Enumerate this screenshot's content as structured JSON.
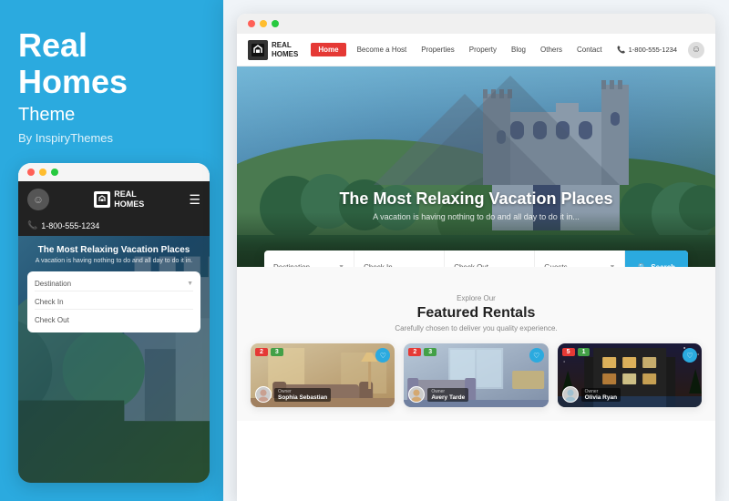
{
  "left": {
    "title_line1": "Real",
    "title_line2": "Homes",
    "subtitle": "Theme",
    "by": "By InspiryThemes",
    "mobile_preview": {
      "phone_number": "1-800-555-1234",
      "logo_text_line1": "REAL",
      "logo_text_line2": "HOMES",
      "hero_title": "The Most Relaxing Vacation Places",
      "hero_sub": "A vacation is having nothing to do and all day to do it in.",
      "search_fields": [
        "Destination",
        "Check In",
        "Check Out"
      ]
    }
  },
  "right": {
    "nav": {
      "logo_line1": "REAL",
      "logo_line2": "HOMES",
      "items": [
        "Home",
        "Become a Host",
        "Properties",
        "Property",
        "Blog",
        "Others",
        "Contact"
      ],
      "phone": "1-800-555-1234"
    },
    "hero": {
      "title": "The Most Relaxing Vacation Places",
      "subtitle": "A vacation is having nothing to do and all day to do it in...",
      "search": {
        "destination": "Destination",
        "check_in": "Check In",
        "check_out": "Check Out",
        "guests": "Guests",
        "btn": "Search"
      }
    },
    "featured": {
      "label": "Explore Our",
      "title": "Featured Rentals",
      "subtitle": "Carefully chosen to deliver you quality experience.",
      "cards": [
        {
          "badges": [
            "2",
            "3"
          ],
          "owner_label": "Owner",
          "owner_name": "Sophia Sebastian"
        },
        {
          "badges": [
            "2",
            "3"
          ],
          "owner_label": "Owner",
          "owner_name": "Avery Tarde"
        },
        {
          "badges": [
            "5",
            "1"
          ],
          "owner_label": "Owner",
          "owner_name": "Olivia Ryan"
        }
      ]
    }
  },
  "dots": {
    "red": "#ff6057",
    "yellow": "#ffbd2e",
    "green": "#27c93f"
  }
}
